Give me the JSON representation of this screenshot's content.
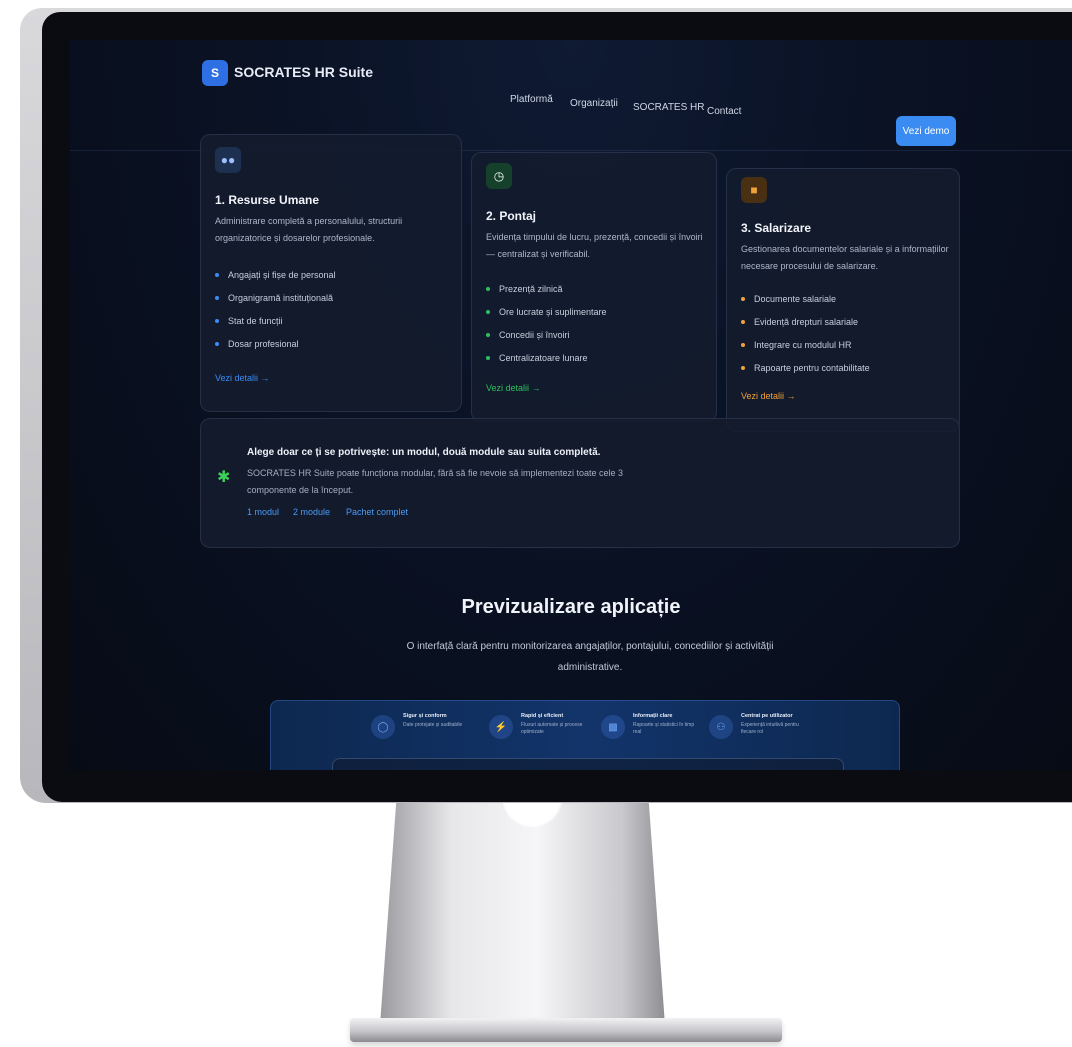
{
  "brand": {
    "logo_letter": "S",
    "name": "SOCRATES HR Suite"
  },
  "nav": {
    "links": [
      "Platformă",
      "Organizații",
      "SOCRATES HR",
      "Contact"
    ],
    "cta": "Vezi demo"
  },
  "modules": [
    {
      "icon": "people-icon",
      "title": "1. Resurse Umane",
      "description": "Administrare completă a personalului, structurii organizatorice și dosarelor profesionale.",
      "items": [
        "Angajați și fișe de personal",
        "Organigramă instituțională",
        "Stat de funcții",
        "Dosar profesional"
      ],
      "link": "Vezi detalii →",
      "accent": "#3b8cf2"
    },
    {
      "icon": "clock-icon",
      "title": "2. Pontaj",
      "description": "Evidența timpului de lucru, prezență, concedii și învoiri — centralizat și verificabil.",
      "items": [
        "Prezență zilnică",
        "Ore lucrate și suplimentare",
        "Concedii și învoiri",
        "Centralizatoare lunare"
      ],
      "link": "Vezi detalii →",
      "accent": "#2fbf5f"
    },
    {
      "icon": "wallet-icon",
      "title": "3. Salarizare",
      "description": "Gestionarea documentelor salariale și a informațiilor necesare procesului de salarizare.",
      "items": [
        "Documente salariale",
        "Evidență drepturi salariale",
        "Integrare cu modulul HR",
        "Rapoarte pentru contabilitate"
      ],
      "link": "Vezi detalii →",
      "accent": "#f0a23a"
    }
  ],
  "banner": {
    "title": "Alege doar ce ți se potrivește: un modul, două module sau suita completă.",
    "text": "SOCRATES HR Suite poate funcționa modular, fără să fie nevoie să implementezi toate cele 3 componente de la început.",
    "options": [
      "1 modul",
      "2 module",
      "Pachet complet"
    ]
  },
  "preview": {
    "title": "Previzualizare aplicație",
    "subtitle": "O interfață clară pentru monitorizarea angajaților, pontajului, concediilor și activității administrative."
  },
  "features": [
    {
      "icon": "shield-icon",
      "title": "Sigur și conform",
      "text": "Date protejate și auditabile"
    },
    {
      "icon": "bolt-icon",
      "title": "Rapid și eficient",
      "text": "Fluxuri automate și procese optimizate"
    },
    {
      "icon": "chart-icon",
      "title": "Informații clare",
      "text": "Rapoarte și statistici în timp real"
    },
    {
      "icon": "users-icon",
      "title": "Centrat pe utilizator",
      "text": "Experiență intuitivă pentru fiecare rol"
    }
  ]
}
